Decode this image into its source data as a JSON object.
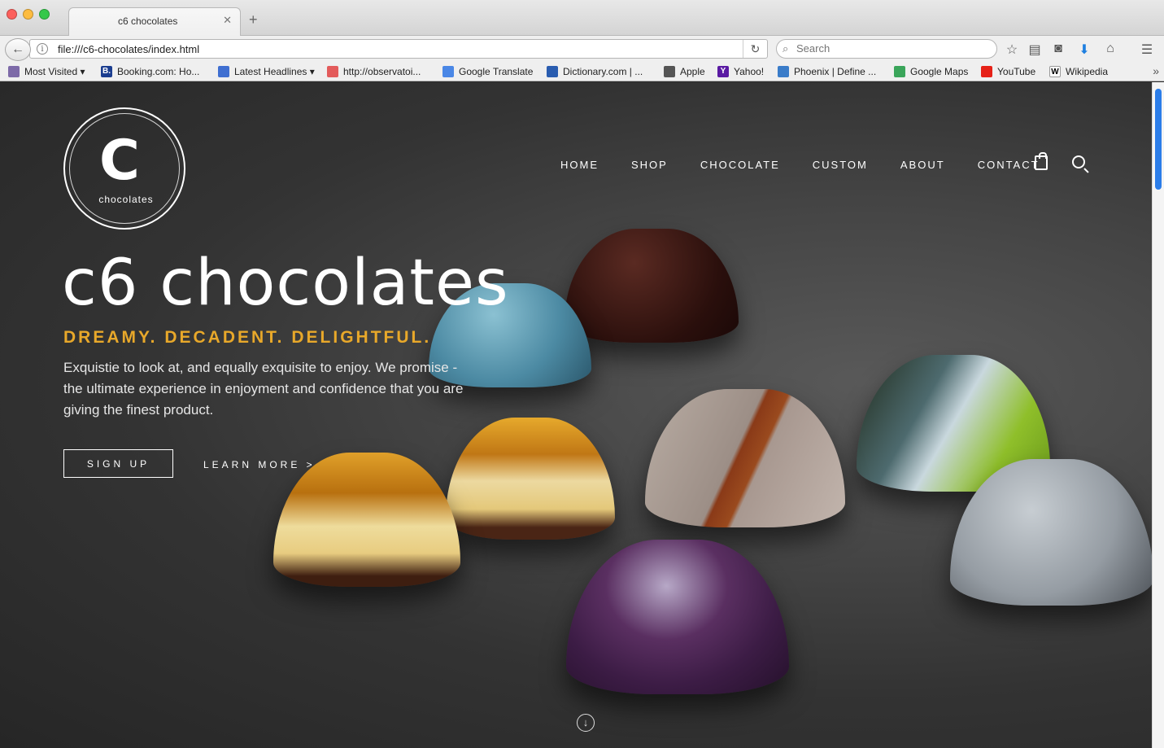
{
  "browser": {
    "tab_title": "c6 chocolates",
    "url": "file:///c6-chocolates/index.html",
    "search_placeholder": "Search",
    "bookmarks": [
      {
        "label": "Most Visited ▾",
        "color": "#7d6aa8",
        "icon": "folder-icon"
      },
      {
        "label": "Booking.com: Ho...",
        "color": "#1b3d8f",
        "icon": "booking-icon",
        "glyph": "B."
      },
      {
        "label": "Latest Headlines ▾",
        "color": "#3f6fd1",
        "icon": "rss-icon"
      },
      {
        "label": "http://observatoi...",
        "color": "#e35b5b",
        "icon": "page-icon"
      },
      {
        "label": "Google Translate",
        "color": "#4a87e6",
        "icon": "translate-icon"
      },
      {
        "label": "Dictionary.com | ...",
        "color": "#2a5db0",
        "icon": "dictionary-icon"
      },
      {
        "label": "Apple",
        "color": "#555555",
        "icon": "apple-icon"
      },
      {
        "label": "Yahoo!",
        "color": "#5a1aa3",
        "icon": "yahoo-icon",
        "glyph": "Y"
      },
      {
        "label": "Phoenix | Define ...",
        "color": "#3a7cc9",
        "icon": "page-icon"
      },
      {
        "label": "Google Maps",
        "color": "#3aa55a",
        "icon": "maps-icon"
      },
      {
        "label": "YouTube",
        "color": "#e62117",
        "icon": "youtube-icon"
      },
      {
        "label": "Wikipedia",
        "color": "#ffffff",
        "icon": "wikipedia-icon",
        "glyph": "W"
      }
    ]
  },
  "site": {
    "logo_text": "chocolates",
    "logo_letter": "C",
    "nav": [
      "HOME",
      "SHOP",
      "CHOCOLATE",
      "CUSTOM",
      "ABOUT",
      "CONTACT"
    ],
    "hero_title": "c6 chocolates",
    "tagline": "DREAMY. DECADENT. DELIGHTFUL.",
    "description": "Exquistie to look at, and equally exquisite to enjoy. We promise - the ultimate experience in enjoyment and confidence that you are giving the finest product.",
    "signup_label": "SIGN UP",
    "learn_more_label": "LEARN MORE >",
    "accent_color": "#e8a82a"
  }
}
